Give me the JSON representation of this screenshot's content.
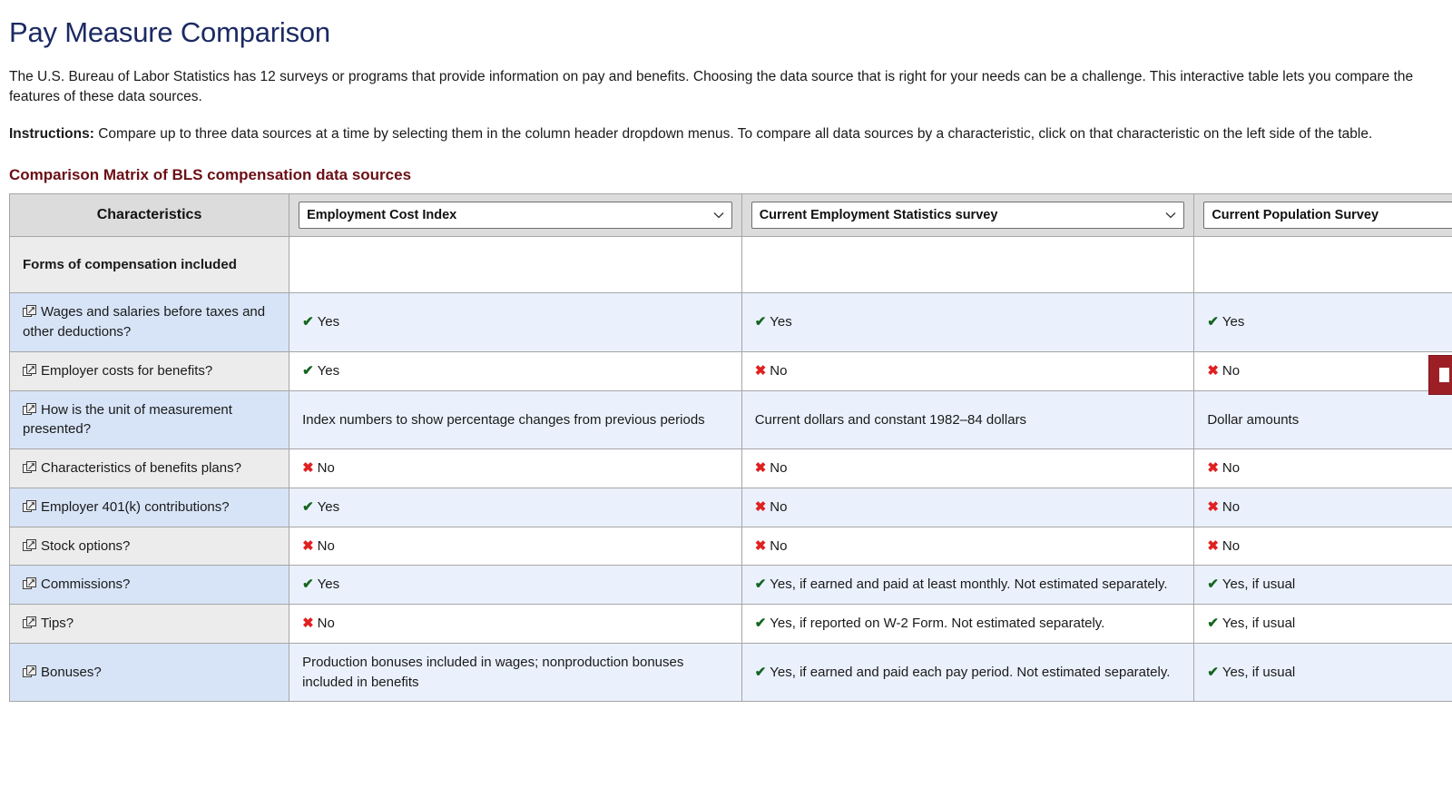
{
  "header": {
    "title": "Pay Measure Comparison",
    "intro": "The U.S. Bureau of Labor Statistics has 12 surveys or programs that provide information on pay and benefits. Choosing the data source that is right for your needs can be a challenge. This interactive table lets you compare the features of these data sources.",
    "instructions_label": "Instructions:",
    "instructions_text": "Compare up to three data sources at a time by selecting them in the column header dropdown menus. To compare all data sources by a characteristic, click on that characteristic on the left side of the table.",
    "matrix_title": "Comparison Matrix of BLS compensation data sources"
  },
  "colors": {
    "title": "#1b2a63",
    "matrix_title": "#6b0f15",
    "yes": "#14661e",
    "no": "#e02020",
    "side_tab": "#9d1f26",
    "row_blue": "#d7e4f7",
    "row_gray": "#ececec",
    "cell_blue": "#eaf1fc",
    "header_gray": "#dcdcdc"
  },
  "table": {
    "characteristics_header": "Characteristics",
    "chevron_glyph": "⌄",
    "columns": [
      {
        "selected": "Employment Cost Index"
      },
      {
        "selected": "Current Employment Statistics survey"
      },
      {
        "selected": "Current Population Survey"
      }
    ],
    "section": {
      "label": "Forms of compensation included"
    },
    "row_icon_name": "popup-window-icon",
    "yes_mark": "✔",
    "no_mark": "✖",
    "rows": [
      {
        "characteristic": "Wages and salaries before taxes and other deductions?",
        "cells": [
          {
            "mark": "yes",
            "text": "Yes"
          },
          {
            "mark": "yes",
            "text": "Yes"
          },
          {
            "mark": "yes",
            "text": "Yes"
          }
        ]
      },
      {
        "characteristic": "Employer costs for benefits?",
        "cells": [
          {
            "mark": "yes",
            "text": "Yes"
          },
          {
            "mark": "no",
            "text": "No"
          },
          {
            "mark": "no",
            "text": "No"
          }
        ]
      },
      {
        "characteristic": "How is the unit of measurement presented?",
        "cells": [
          {
            "mark": "none",
            "text": "Index numbers to show percentage changes from previous periods"
          },
          {
            "mark": "none",
            "text": "Current dollars and constant 1982–84 dollars"
          },
          {
            "mark": "none",
            "text": "Dollar amounts"
          }
        ]
      },
      {
        "characteristic": "Characteristics of benefits plans?",
        "cells": [
          {
            "mark": "no",
            "text": "No"
          },
          {
            "mark": "no",
            "text": "No"
          },
          {
            "mark": "no",
            "text": "No"
          }
        ]
      },
      {
        "characteristic": "Employer 401(k) contributions?",
        "cells": [
          {
            "mark": "yes",
            "text": "Yes"
          },
          {
            "mark": "no",
            "text": "No"
          },
          {
            "mark": "no",
            "text": "No"
          }
        ]
      },
      {
        "characteristic": "Stock options?",
        "cells": [
          {
            "mark": "no",
            "text": "No"
          },
          {
            "mark": "no",
            "text": "No"
          },
          {
            "mark": "no",
            "text": "No"
          }
        ]
      },
      {
        "characteristic": "Commissions?",
        "cells": [
          {
            "mark": "yes",
            "text": "Yes"
          },
          {
            "mark": "yes",
            "text": "Yes, if earned and paid at least monthly. Not estimated separately."
          },
          {
            "mark": "yes",
            "text": "Yes, if usual"
          }
        ]
      },
      {
        "characteristic": "Tips?",
        "cells": [
          {
            "mark": "no",
            "text": "No"
          },
          {
            "mark": "yes",
            "text": "Yes, if reported on W-2 Form. Not estimated separately."
          },
          {
            "mark": "yes",
            "text": "Yes, if usual"
          }
        ]
      },
      {
        "characteristic": "Bonuses?",
        "cells": [
          {
            "mark": "none",
            "text": "Production bonuses included in wages; nonproduction bonuses included in benefits"
          },
          {
            "mark": "yes",
            "text": "Yes, if earned and paid each pay period. Not estimated separately."
          },
          {
            "mark": "yes",
            "text": "Yes, if usual"
          }
        ]
      }
    ]
  }
}
